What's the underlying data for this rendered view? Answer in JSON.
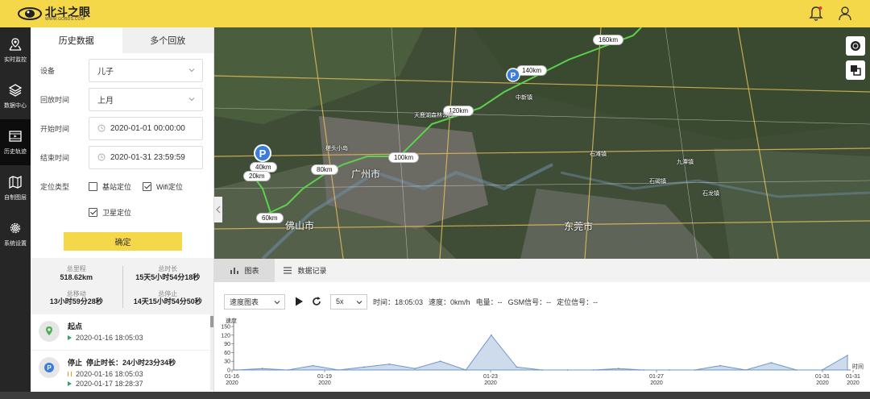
{
  "app": {
    "name": "北斗之眼",
    "url": "WWW.GOBDS.COM"
  },
  "nav": [
    {
      "label": "实时监控",
      "icon": "map-marker-icon"
    },
    {
      "label": "数据中心",
      "icon": "layers-icon"
    },
    {
      "label": "历史轨迹",
      "icon": "film-icon"
    },
    {
      "label": "自制图层",
      "icon": "map-icon"
    },
    {
      "label": "系统设置",
      "icon": "gear-icon"
    }
  ],
  "panel": {
    "tabs": [
      "历史数据",
      "多个回放"
    ],
    "device_label": "设备",
    "device_value": "儿子",
    "period_label": "回放时间",
    "period_value": "上月",
    "start_label": "开始时间",
    "start_value": "2020-01-01 00:00:00",
    "end_label": "结束时间",
    "end_value": "2020-01-31 23:59:59",
    "loc_type_label": "定位类型",
    "loc_types": [
      {
        "label": "基站定位",
        "checked": false
      },
      {
        "label": "Wifi定位",
        "checked": true
      },
      {
        "label": "卫星定位",
        "checked": true
      }
    ],
    "confirm_label": "确定"
  },
  "stats": [
    {
      "label": "总里程",
      "value": "518.62km"
    },
    {
      "label": "总时长",
      "value": "15天5小时54分18秒"
    },
    {
      "label": "总移动",
      "value": "13小时59分28秒"
    },
    {
      "label": "总停止",
      "value": "14天15小时54分50秒"
    }
  ],
  "events": {
    "start_title": "起点",
    "start_time": "2020-01-16 18:05:03",
    "stop_title": "停止",
    "stop_duration": "停止时长：24小时23分34秒",
    "stop_from": "2020-01-16 18:05:03",
    "stop_to": "2020-01-17 18:28:37"
  },
  "map": {
    "km_labels": [
      "160km",
      "140km",
      "120km",
      "100km",
      "80km",
      "60km",
      "40km",
      "20km"
    ],
    "cities": [
      "广州市",
      "佛山市",
      "东莞市"
    ],
    "places": [
      "天鹿湖森林公园",
      "槎头小岛",
      "中新镇",
      "石滩镇",
      "石碣镇",
      "石龙镇",
      "九潭镇"
    ]
  },
  "bottom": {
    "tabs": [
      "图表",
      "数据记录"
    ],
    "chart_select": "速度图表",
    "speed_select": "5x",
    "time_label": "时间：18:05:03",
    "speed_label": "速度：0km/h",
    "power_label": "电量：--",
    "gsm_label": "GSM信号：--",
    "loc_signal_label": "定位信号：--"
  },
  "chart_data": {
    "type": "area",
    "ylabel": "速度",
    "xlabel": "时间",
    "ylim": [
      0,
      150
    ],
    "yticks": [
      "150",
      "120",
      "90",
      "60",
      "30",
      "0"
    ],
    "xticks": [
      {
        "date": "01-16",
        "year": "2020"
      },
      {
        "date": "01-19",
        "year": "2020"
      },
      {
        "date": "01-23",
        "year": "2020"
      },
      {
        "date": "01-27",
        "year": "2020"
      },
      {
        "date": "01-31",
        "year": "2020"
      },
      {
        "date": "01-31",
        "year": "2020"
      }
    ],
    "x": [
      "01-16",
      "01-17",
      "01-17",
      "01-18",
      "01-18",
      "01-19",
      "01-19",
      "01-20",
      "01-20",
      "01-20",
      "01-20",
      "01-21",
      "01-21",
      "01-21",
      "01-22",
      "01-23",
      "01-24",
      "01-25",
      "01-26",
      "01-27",
      "01-28",
      "01-29",
      "01-30",
      "01-31",
      "01-31"
    ],
    "values": [
      0,
      5,
      0,
      15,
      0,
      10,
      20,
      5,
      30,
      0,
      120,
      10,
      0,
      0,
      0,
      5,
      0,
      0,
      0,
      15,
      0,
      25,
      0,
      0,
      50
    ],
    "color": "#6f97c9"
  }
}
